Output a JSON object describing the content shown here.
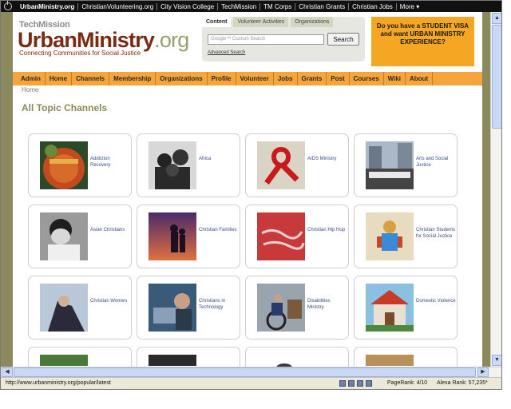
{
  "topbar": {
    "links": [
      "UrbanMinistry.org",
      "ChristianVolunteering.org",
      "City Vision College",
      "TechMission",
      "TM Corps",
      "Christian Grants",
      "Christian Jobs",
      "More ▾"
    ]
  },
  "header": {
    "logo_small": "TechMission",
    "logo_main_a": "UrbanMinistry",
    "logo_main_b": ".org",
    "tagline": "Connecting Communities for Social Justice"
  },
  "search": {
    "tabs": [
      "Content",
      "Volunteer Activities",
      "Organizations"
    ],
    "active_tab": "Content",
    "placeholder": "Google™ Custom Search",
    "button_label": "Search",
    "advanced_link": "Advanced Search"
  },
  "ad": {
    "text": "Do you have a STUDENT VISA and want URBAN MINISTRY EXPERIENCE?"
  },
  "nav": {
    "items": [
      "Admin",
      "Home",
      "Channels",
      "Membership",
      "Organizations",
      "Profile",
      "Volunteer",
      "Jobs",
      "Grants",
      "Post",
      "Courses",
      "Wiki",
      "About"
    ]
  },
  "breadcrumb": "Home",
  "page_title": "All Topic Channels",
  "channels": [
    {
      "label": "Addiction Recovery",
      "icon": "addiction-recovery-photo"
    },
    {
      "label": "Africa",
      "icon": "africa-photo"
    },
    {
      "label": "AIDS Ministry",
      "icon": "aids-ribbon-photo"
    },
    {
      "label": "Arts and Social Justice",
      "icon": "graffiti-wall-photo"
    },
    {
      "label": "Asian Christians",
      "icon": "asian-child-photo"
    },
    {
      "label": "Christian Families",
      "icon": "family-silhouette-photo"
    },
    {
      "label": "Christian Hip Hop",
      "icon": "hip-hop-graffiti-photo"
    },
    {
      "label": "Christian Students for Social Justice",
      "icon": "students-art-photo"
    },
    {
      "label": "Christian Women",
      "icon": "christian-woman-photo"
    },
    {
      "label": "Christians in Technology",
      "icon": "technology-photo"
    },
    {
      "label": "Disabilities Ministry",
      "icon": "wheelchair-photo"
    },
    {
      "label": "Domestic Violence",
      "icon": "house-photo"
    }
  ],
  "status": {
    "url": "http://www.urbanministry.org/popular/latest",
    "pagerank": "PageRank: 4/10",
    "alexa": "Alexa Rank: 57,235*"
  },
  "colors": {
    "brand_dark": "#7a2a12",
    "brand_light": "#9aa06a",
    "nav_orange": "#f5a53a",
    "ad_orange": "#f5a623",
    "page_olive": "#8a8a5c"
  }
}
